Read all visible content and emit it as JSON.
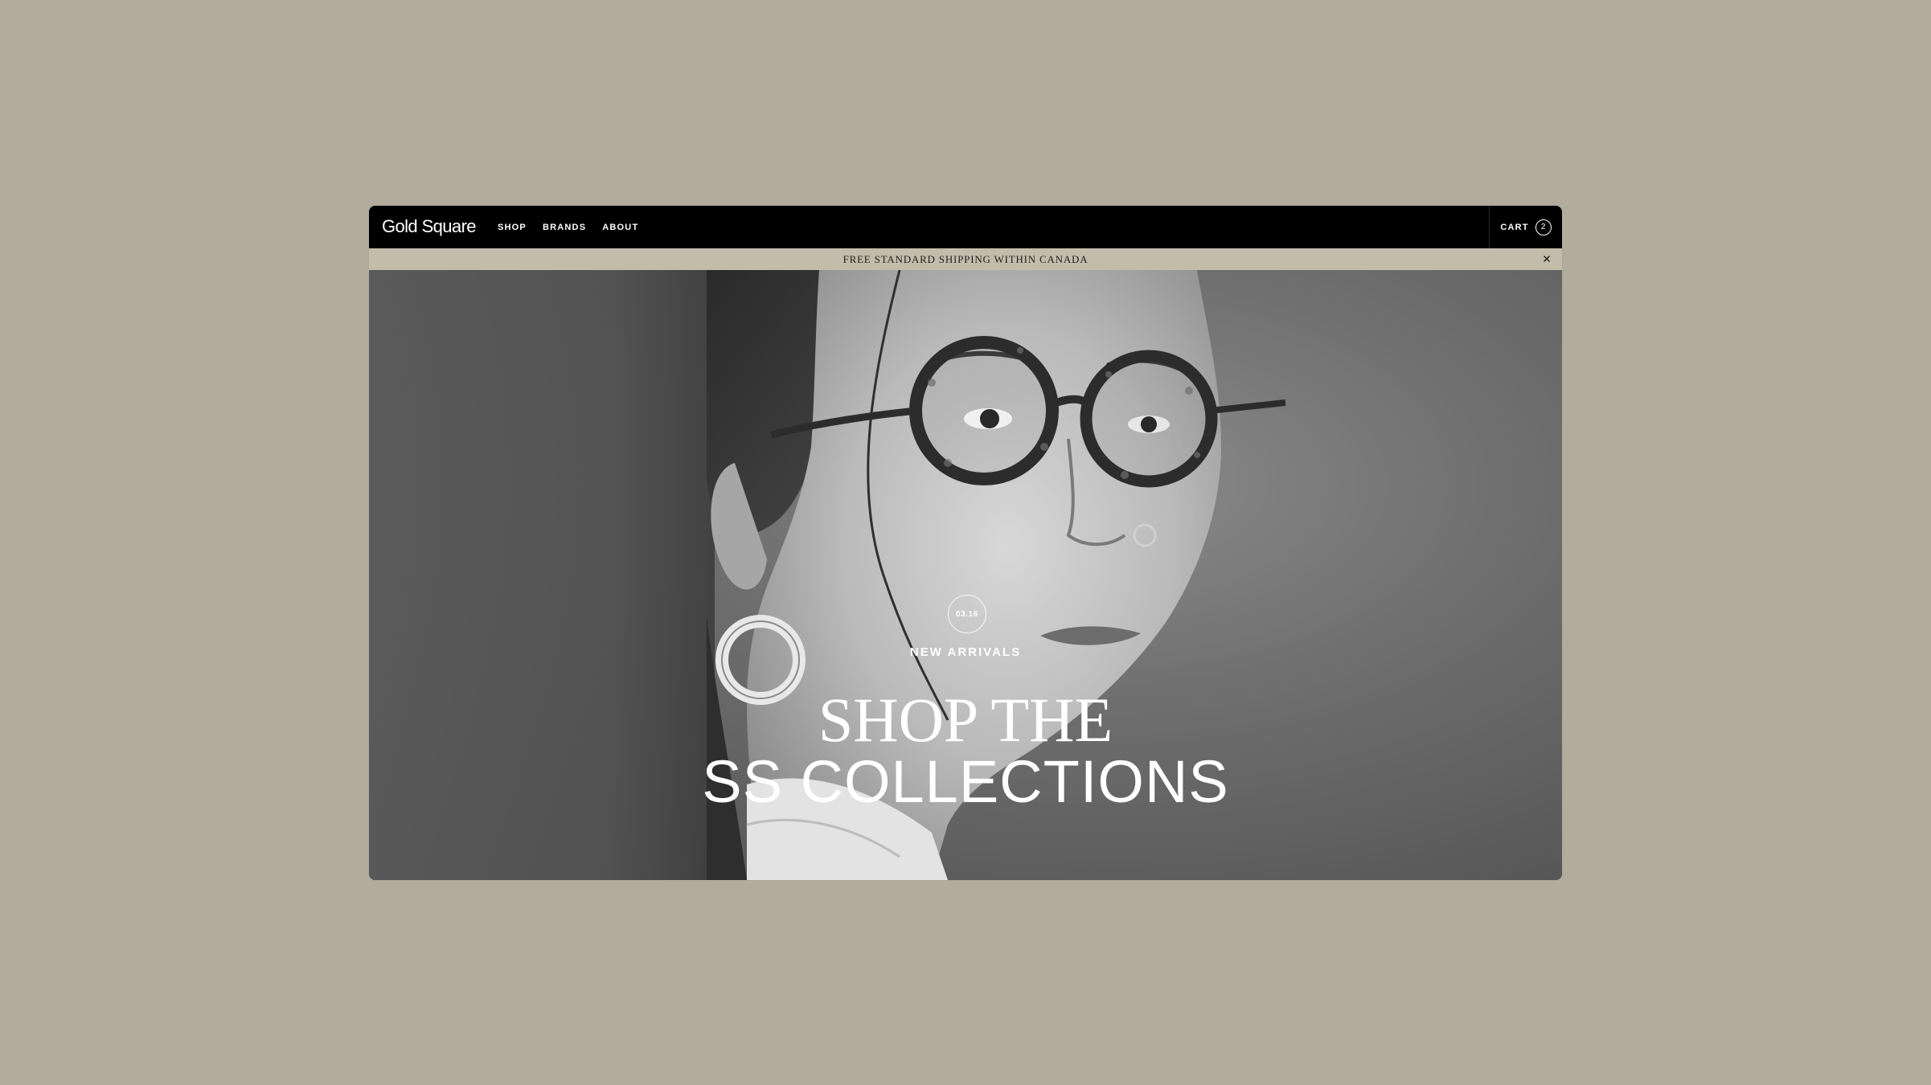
{
  "header": {
    "brand": "Gold Square",
    "nav": [
      {
        "label": "SHOP"
      },
      {
        "label": "BRANDS"
      },
      {
        "label": "ABOUT"
      }
    ],
    "cart": {
      "label": "CART",
      "count": "2"
    }
  },
  "announcement": {
    "text": "FREE STANDARD SHIPPING WITHIN CANADA"
  },
  "hero": {
    "date_badge": "03.16",
    "eyebrow": "NEW ARRIVALS",
    "headline_line1": "SHOP THE",
    "headline_line2": "SS COLLECTIONS"
  },
  "colors": {
    "page_background": "#b3ab9e",
    "header_background": "#000000",
    "announcement_background": "#c4bcab",
    "text_light": "#ffffff"
  },
  "icons": {
    "close": "close-icon",
    "cart_count": "cart-count-badge"
  }
}
